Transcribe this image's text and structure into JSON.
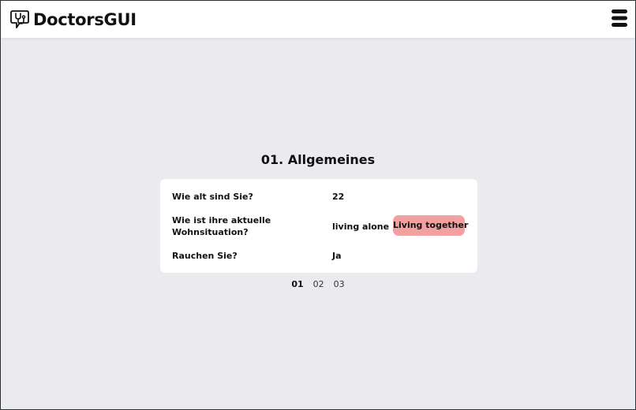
{
  "app": {
    "name": "DoctorsGUI",
    "logo_icon": "stethoscope-speech-bubble-icon",
    "menu_icon": "hamburger-menu-icon"
  },
  "section": {
    "title": "01. Allgemeines"
  },
  "questions": [
    {
      "label": "Wie alt sind Sie?",
      "answer": "22"
    },
    {
      "label": "Wie ist ihre aktuelle Wohnsituation?",
      "options": [
        "living alone",
        "Living together"
      ],
      "selected": "Living together"
    },
    {
      "label": "Rauchen Sie?",
      "answer": "Ja"
    }
  ],
  "pagination": {
    "pages": [
      "01",
      "02",
      "03"
    ],
    "current": "01"
  },
  "colors": {
    "background": "#ebeaef",
    "card": "#ffffff",
    "selected_option": "#f2a0a0"
  }
}
